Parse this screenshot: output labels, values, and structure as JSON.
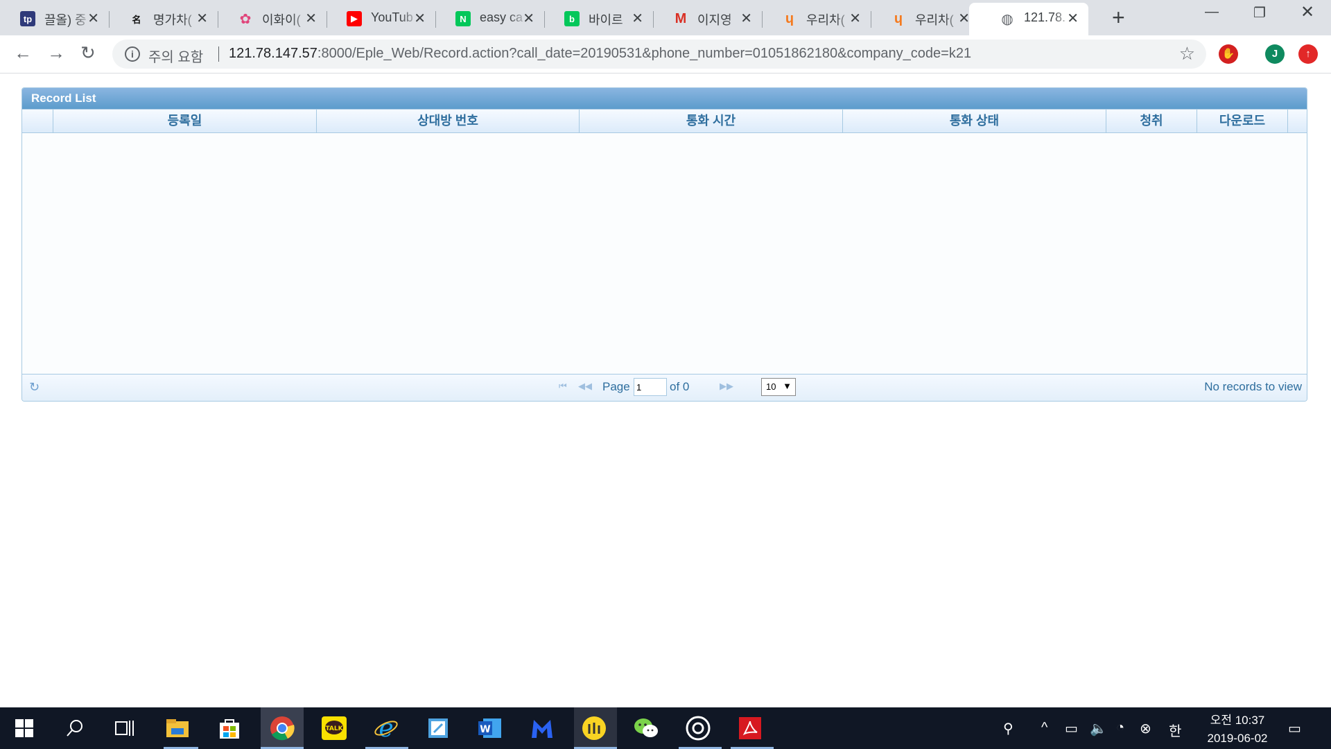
{
  "browser": {
    "tabs": [
      {
        "title": "끌올) 중",
        "favicon": "tp-logo-icon",
        "color": "#2f3a7a",
        "glyph": "tp"
      },
      {
        "title": "명가차(",
        "favicon": "myungga-logo-icon",
        "color": "#ffffff",
        "glyph": "名"
      },
      {
        "title": "이화이(",
        "favicon": "ewha-flower-icon",
        "color": "#e0457b",
        "glyph": "✿"
      },
      {
        "title": "YouTub",
        "favicon": "youtube-icon",
        "color": "#ff0000",
        "glyph": "▶"
      },
      {
        "title": "easy ca",
        "favicon": "naver-icon",
        "color": "#03c75a",
        "glyph": "N"
      },
      {
        "title": "바이르",
        "favicon": "naver-blog-icon",
        "color": "#03c75a",
        "glyph": "b"
      },
      {
        "title": "이지영",
        "favicon": "gmail-icon",
        "color": "#d93025",
        "glyph": "M"
      },
      {
        "title": "우리차(",
        "favicon": "woori-logo-icon",
        "color": "#f47b20",
        "glyph": "ɥ"
      },
      {
        "title": "우리차(",
        "favicon": "woori-logo-icon",
        "color": "#f47b20",
        "glyph": "ɥ"
      },
      {
        "title": "121.78.",
        "favicon": "globe-icon",
        "color": "#5f6368",
        "glyph": "◍",
        "active": true
      }
    ],
    "security_label": "주의 요함",
    "url_host": "121.78.147.57",
    "url_rest": ":8000/Eple_Web/Record.action?call_date=20190531&phone_number=01051862180&company_code=k21",
    "profile_initial": "J"
  },
  "grid": {
    "caption": "Record List",
    "columns": [
      "등록일",
      "상대방 번호",
      "통화 시간",
      "통화 상태",
      "청취",
      "다운로드"
    ],
    "rows": [],
    "pager": {
      "page_label": "Page",
      "page_value": "1",
      "of_label": "of 0",
      "rows_per_page": "10",
      "records_text": "No records to view"
    }
  },
  "taskbar": {
    "clock_time": "오전 10:37",
    "clock_date": "2019-06-02",
    "ime": "한"
  }
}
